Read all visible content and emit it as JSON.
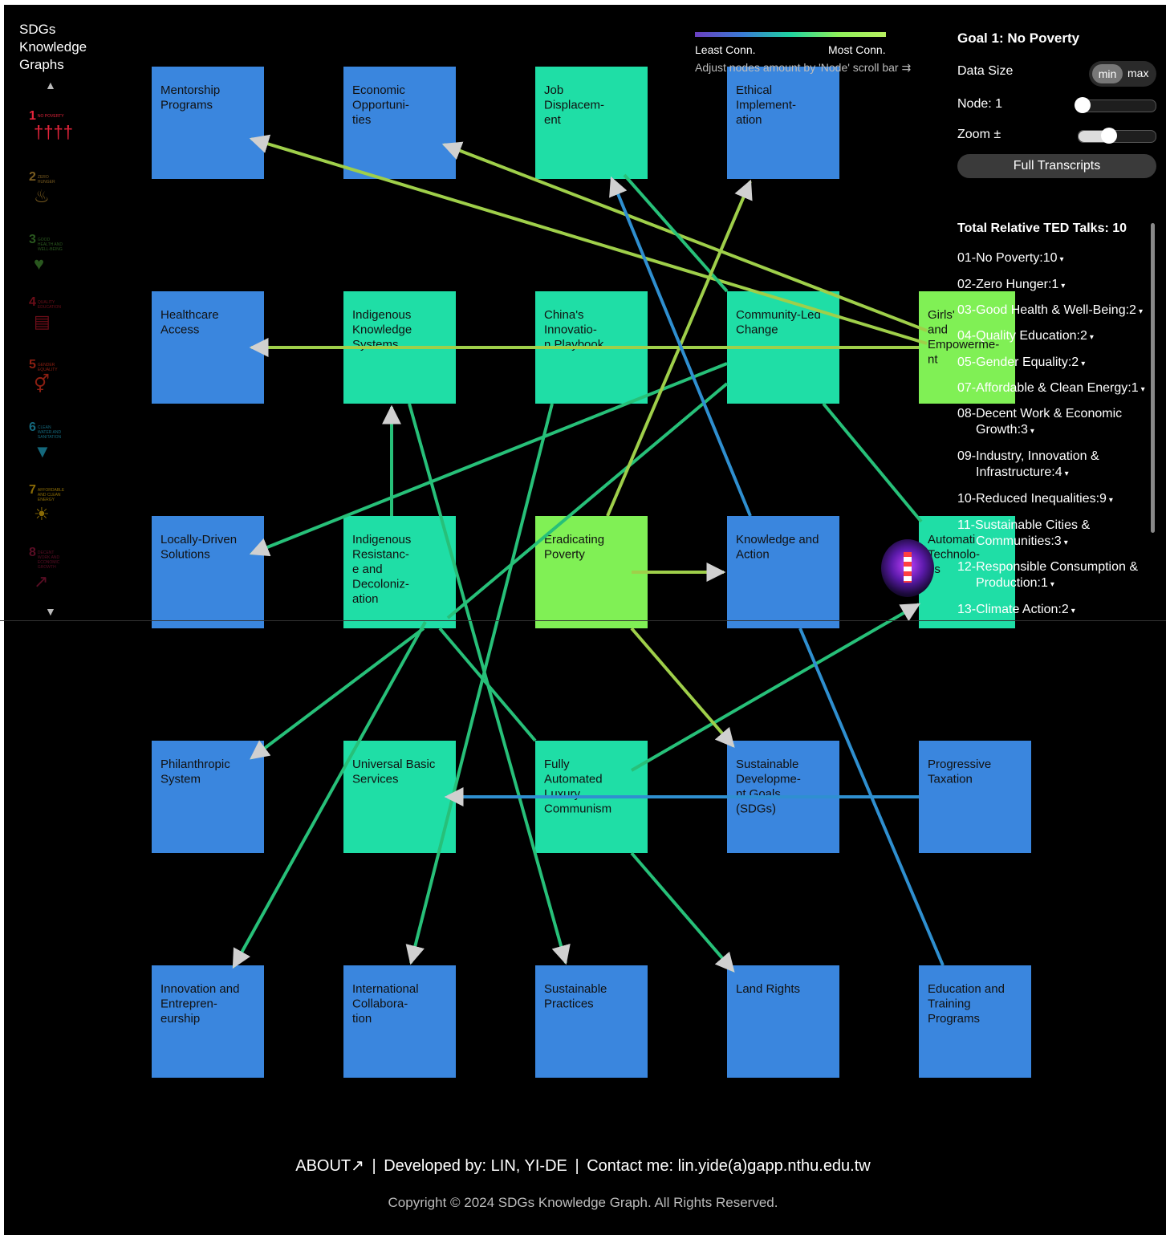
{
  "brand": "SDGs Knowledge Graphs",
  "sdg_nav": [
    {
      "num": "1",
      "label": "NO POVERTY",
      "icon": "people-icon",
      "color": "#e5243b",
      "glyph": "††††"
    },
    {
      "num": "2",
      "label": "ZERO HUNGER",
      "icon": "bowl-icon",
      "color": "#dda63a",
      "glyph": "♨"
    },
    {
      "num": "3",
      "label": "GOOD HEALTH AND WELL-BEING",
      "icon": "heartbeat-icon",
      "color": "#4c9f38",
      "glyph": "♥"
    },
    {
      "num": "4",
      "label": "QUALITY EDUCATION",
      "icon": "book-icon",
      "color": "#c5192d",
      "glyph": "▤"
    },
    {
      "num": "5",
      "label": "GENDER EQUALITY",
      "icon": "gender-icon",
      "color": "#ff3a21",
      "glyph": "⚥"
    },
    {
      "num": "6",
      "label": "CLEAN WATER AND SANITATION",
      "icon": "water-icon",
      "color": "#26bde2",
      "glyph": "▼"
    },
    {
      "num": "7",
      "label": "AFFORDABLE AND CLEAN ENERGY",
      "icon": "sun-icon",
      "color": "#fcc30b",
      "glyph": "☀"
    },
    {
      "num": "8",
      "label": "DECENT WORK AND ECONOMIC GROWTH",
      "icon": "chart-icon",
      "color": "#a21942",
      "glyph": "↗"
    }
  ],
  "legend": {
    "least": "Least Conn.",
    "most": "Most Conn.",
    "hint": "Adjust nodes amount by 'Node' scroll bar ⇉"
  },
  "panel": {
    "goal_title": "Goal 1: No Poverty",
    "data_size_label": "Data Size",
    "min": "min",
    "max": "max",
    "node_label": "Node: 1",
    "node_level": 0.05,
    "zoom_label": "Zoom ±",
    "zoom_level": 0.4,
    "full_transcripts": "Full Transcripts",
    "talks_title": "Total Relative TED Talks: 10",
    "talks": [
      {
        "line1": "01-No Poverty:10",
        "line2": ""
      },
      {
        "line1": "02-Zero Hunger:1",
        "line2": ""
      },
      {
        "line1": "03-Good Health & Well-Being:2",
        "line2": ""
      },
      {
        "line1": "04-Quality Education:2",
        "line2": ""
      },
      {
        "line1": "05-Gender Equality:2",
        "line2": ""
      },
      {
        "line1": "07-Affordable & Clean Energy:1",
        "line2": ""
      },
      {
        "line1": "08-Decent Work & Economic",
        "line2": "Growth:3"
      },
      {
        "line1": "09-Industry, Innovation &",
        "line2": "Infrastructure:4"
      },
      {
        "line1": "10-Reduced Inequalities:9",
        "line2": ""
      },
      {
        "line1": "11-Sustainable Cities &",
        "line2": "Communities:3"
      },
      {
        "line1": "12-Responsible Consumption &",
        "line2": "Production:1"
      },
      {
        "line1": "13-Climate Action:2",
        "line2": ""
      }
    ]
  },
  "colors": {
    "node_blue": "#3a86de",
    "node_teal": "#1fdea6",
    "node_lime": "#80f055",
    "edge_blue": "#2f8fd0",
    "edge_green": "#27c079",
    "edge_lime": "#9fcf4a"
  },
  "graph": {
    "nodes": [
      {
        "id": "mentorship",
        "lines": [
          "Mentorship",
          "Programs"
        ],
        "tier": "blue"
      },
      {
        "id": "economic-opp",
        "lines": [
          "Economic",
          "Opportuni-",
          "ties"
        ],
        "tier": "blue"
      },
      {
        "id": "job-displacement",
        "lines": [
          "Job",
          "Displacem-",
          "ent"
        ],
        "tier": "teal"
      },
      {
        "id": "ethical",
        "lines": [
          "Ethical",
          "Implement-",
          "ation"
        ],
        "tier": "blue"
      },
      {
        "id": "healthcare",
        "lines": [
          "Healthcare",
          "Access"
        ],
        "tier": "blue"
      },
      {
        "id": "indigenous-knowledge",
        "lines": [
          "Indigenous",
          "Knowledge",
          "Systems"
        ],
        "tier": "teal"
      },
      {
        "id": "china",
        "lines": [
          "China's",
          "Innovatio-",
          "n Playbook"
        ],
        "tier": "teal"
      },
      {
        "id": "community-led",
        "lines": [
          "Community-Led",
          "Change"
        ],
        "tier": "teal"
      },
      {
        "id": "girls",
        "lines": [
          "Girls'",
          "and",
          "Empowerme-",
          "nt"
        ],
        "tier": "lime"
      },
      {
        "id": "locally-driven",
        "lines": [
          "Locally-Driven",
          "Solutions"
        ],
        "tier": "blue"
      },
      {
        "id": "indigenous-resistance",
        "lines": [
          "Indigenous",
          "Resistanc-",
          "e and",
          "Decoloniz-",
          "ation"
        ],
        "tier": "teal"
      },
      {
        "id": "eradicating",
        "lines": [
          "Eradicating",
          "Poverty"
        ],
        "tier": "lime"
      },
      {
        "id": "knowledge-action",
        "lines": [
          "Knowledge and",
          "Action"
        ],
        "tier": "blue"
      },
      {
        "id": "automation",
        "lines": [
          "Automati",
          "Technolo-",
          "es"
        ],
        "tier": "teal"
      },
      {
        "id": "philanthropic",
        "lines": [
          "Philanthropic",
          "System"
        ],
        "tier": "blue"
      },
      {
        "id": "ubs",
        "lines": [
          "Universal Basic",
          "Services"
        ],
        "tier": "teal"
      },
      {
        "id": "falc",
        "lines": [
          "Fully",
          "Automated",
          "Luxury",
          "Communism"
        ],
        "tier": "teal"
      },
      {
        "id": "sdgs",
        "lines": [
          "Sustainable",
          "Developme-",
          "nt Goals",
          "(SDGs)"
        ],
        "tier": "blue"
      },
      {
        "id": "progressive",
        "lines": [
          "Progressive",
          "Taxation"
        ],
        "tier": "blue"
      },
      {
        "id": "innovation",
        "lines": [
          "Innovation and",
          "Entrepren-",
          "eurship"
        ],
        "tier": "blue"
      },
      {
        "id": "intl-collab",
        "lines": [
          "International",
          "Collabora-",
          "tion"
        ],
        "tier": "blue"
      },
      {
        "id": "sust-practices",
        "lines": [
          "Sustainable",
          "Practices"
        ],
        "tier": "blue"
      },
      {
        "id": "land-rights",
        "lines": [
          "Land Rights"
        ],
        "tier": "blue"
      },
      {
        "id": "education",
        "lines": [
          "Education and",
          "Training",
          "Programs"
        ],
        "tier": "blue"
      }
    ]
  },
  "footer": {
    "about": "ABOUT↗",
    "sep1": "|",
    "developer": "Developed by: LIN, YI-DE",
    "sep2": "|",
    "contact": "Contact me: lin.yide(a)gapp.nthu.edu.tw",
    "copyright": "Copyright © 2024 SDGs Knowledge Graph. All Rights Reserved."
  }
}
